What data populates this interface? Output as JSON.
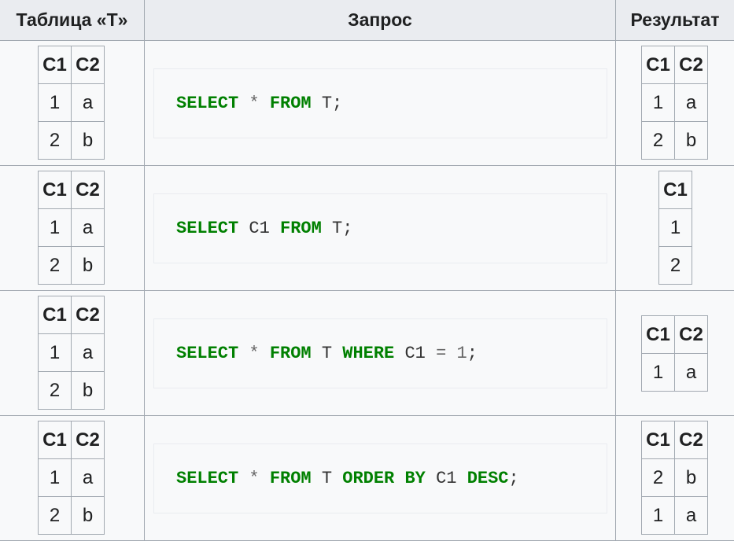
{
  "headers": {
    "table": "Таблица «T»",
    "query": "Запрос",
    "result": "Результат"
  },
  "source_table": {
    "cols": [
      "C1",
      "C2"
    ],
    "rows": [
      [
        "1",
        "a"
      ],
      [
        "2",
        "b"
      ]
    ]
  },
  "rows": [
    {
      "query": [
        [
          "kw",
          "SELECT"
        ],
        [
          "sp",
          " "
        ],
        [
          "op",
          "*"
        ],
        [
          "sp",
          " "
        ],
        [
          "kw",
          "FROM"
        ],
        [
          "sp",
          " "
        ],
        [
          "id",
          "T"
        ],
        [
          "pn",
          ";"
        ]
      ],
      "result": {
        "cols": [
          "C1",
          "C2"
        ],
        "rows": [
          [
            "1",
            "a"
          ],
          [
            "2",
            "b"
          ]
        ]
      }
    },
    {
      "query": [
        [
          "kw",
          "SELECT"
        ],
        [
          "sp",
          " "
        ],
        [
          "id",
          "C1"
        ],
        [
          "sp",
          " "
        ],
        [
          "kw",
          "FROM"
        ],
        [
          "sp",
          " "
        ],
        [
          "id",
          "T"
        ],
        [
          "pn",
          ";"
        ]
      ],
      "result": {
        "cols": [
          "C1"
        ],
        "rows": [
          [
            "1"
          ],
          [
            "2"
          ]
        ]
      }
    },
    {
      "query": [
        [
          "kw",
          "SELECT"
        ],
        [
          "sp",
          " "
        ],
        [
          "op",
          "*"
        ],
        [
          "sp",
          " "
        ],
        [
          "kw",
          "FROM"
        ],
        [
          "sp",
          " "
        ],
        [
          "id",
          "T"
        ],
        [
          "sp",
          " "
        ],
        [
          "kw",
          "WHERE"
        ],
        [
          "sp",
          " "
        ],
        [
          "id",
          "C1"
        ],
        [
          "sp",
          " "
        ],
        [
          "op",
          "="
        ],
        [
          "sp",
          " "
        ],
        [
          "num",
          "1"
        ],
        [
          "pn",
          ";"
        ]
      ],
      "result": {
        "cols": [
          "C1",
          "C2"
        ],
        "rows": [
          [
            "1",
            "a"
          ]
        ]
      }
    },
    {
      "query": [
        [
          "kw",
          "SELECT"
        ],
        [
          "sp",
          " "
        ],
        [
          "op",
          "*"
        ],
        [
          "sp",
          " "
        ],
        [
          "kw",
          "FROM"
        ],
        [
          "sp",
          " "
        ],
        [
          "id",
          "T"
        ],
        [
          "sp",
          " "
        ],
        [
          "kw",
          "ORDER"
        ],
        [
          "sp",
          " "
        ],
        [
          "kw",
          "BY"
        ],
        [
          "sp",
          " "
        ],
        [
          "id",
          "C1"
        ],
        [
          "sp",
          " "
        ],
        [
          "kw",
          "DESC"
        ],
        [
          "pn",
          ";"
        ]
      ],
      "result": {
        "cols": [
          "C1",
          "C2"
        ],
        "rows": [
          [
            "2",
            "b"
          ],
          [
            "1",
            "a"
          ]
        ]
      }
    }
  ]
}
